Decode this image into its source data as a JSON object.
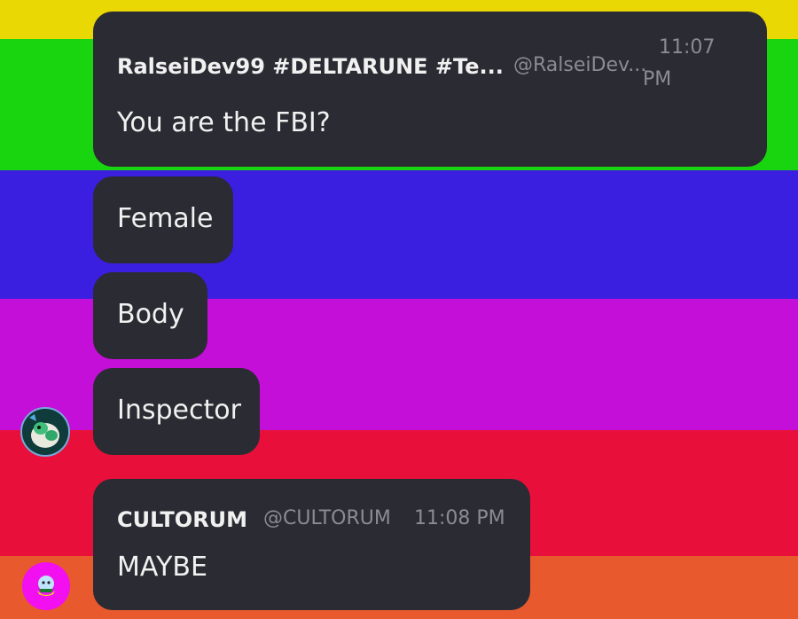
{
  "background": {
    "colors": [
      "#ead804",
      "#19d50f",
      "#3b1fe0",
      "#c30fd8",
      "#e8103a",
      "#e85a2e"
    ]
  },
  "messages": [
    {
      "author": "RalseiDev99 #DELTARUNE #Te...",
      "handle": "@RalseiDev...",
      "time_line1": "11:07",
      "time_line2": "PM",
      "text": "You are the FBI?"
    },
    {
      "text": "Female"
    },
    {
      "text": "Body"
    },
    {
      "text": "Inspector"
    },
    {
      "author": "CULTORUM",
      "handle": "@CULTORUM",
      "time": "11:08 PM",
      "text": "MAYBE"
    }
  ],
  "avatars": {
    "first": {
      "icon": "dragon-avatar-icon"
    },
    "second": {
      "icon": "cat-avatar-icon"
    }
  }
}
